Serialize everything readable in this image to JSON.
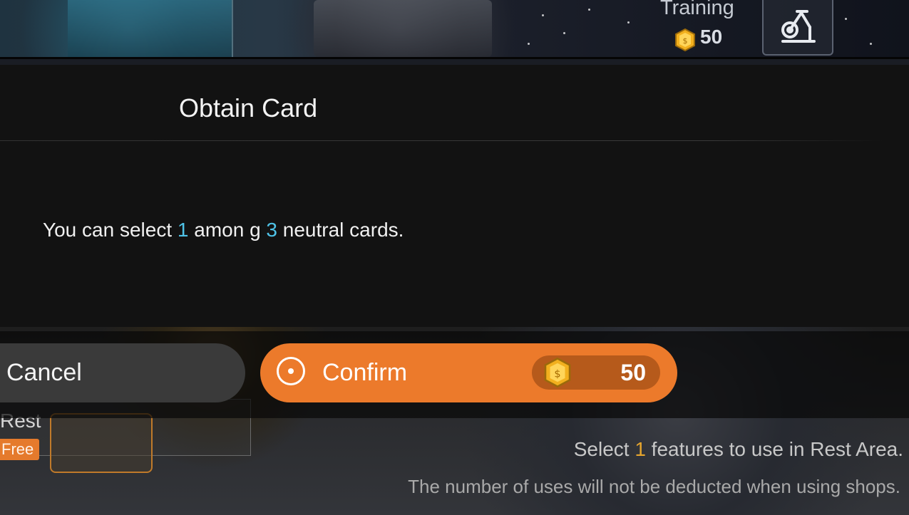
{
  "top_bar": {
    "training_label": "Training",
    "training_cost": "50"
  },
  "dialog": {
    "title": "Obtain Card",
    "message": {
      "part1": "You can select ",
      "num1": "1",
      "part2": " amon g ",
      "num2": "3",
      "part3": " neutral cards."
    }
  },
  "buttons": {
    "cancel_label": "Cancel",
    "confirm_label": "Confirm",
    "confirm_cost": "50"
  },
  "rest_area": {
    "rest_label": "Rest",
    "free_badge": "Free"
  },
  "footer": {
    "line1_prefix": "Select ",
    "line1_count": "1",
    "line1_suffix": " features to use in Rest Area.",
    "line2": "The number of uses will not be deducted when using shops."
  },
  "icons": {
    "coin": "gold-coin-icon",
    "training": "exercise-bike-icon",
    "confirm": "radio-target-icon"
  },
  "colors": {
    "dialog_bg": "#121212",
    "confirm_accent": "#ec7a2b",
    "highlight_number": "#4fc3e8",
    "footer_highlight": "#e6a52e"
  }
}
